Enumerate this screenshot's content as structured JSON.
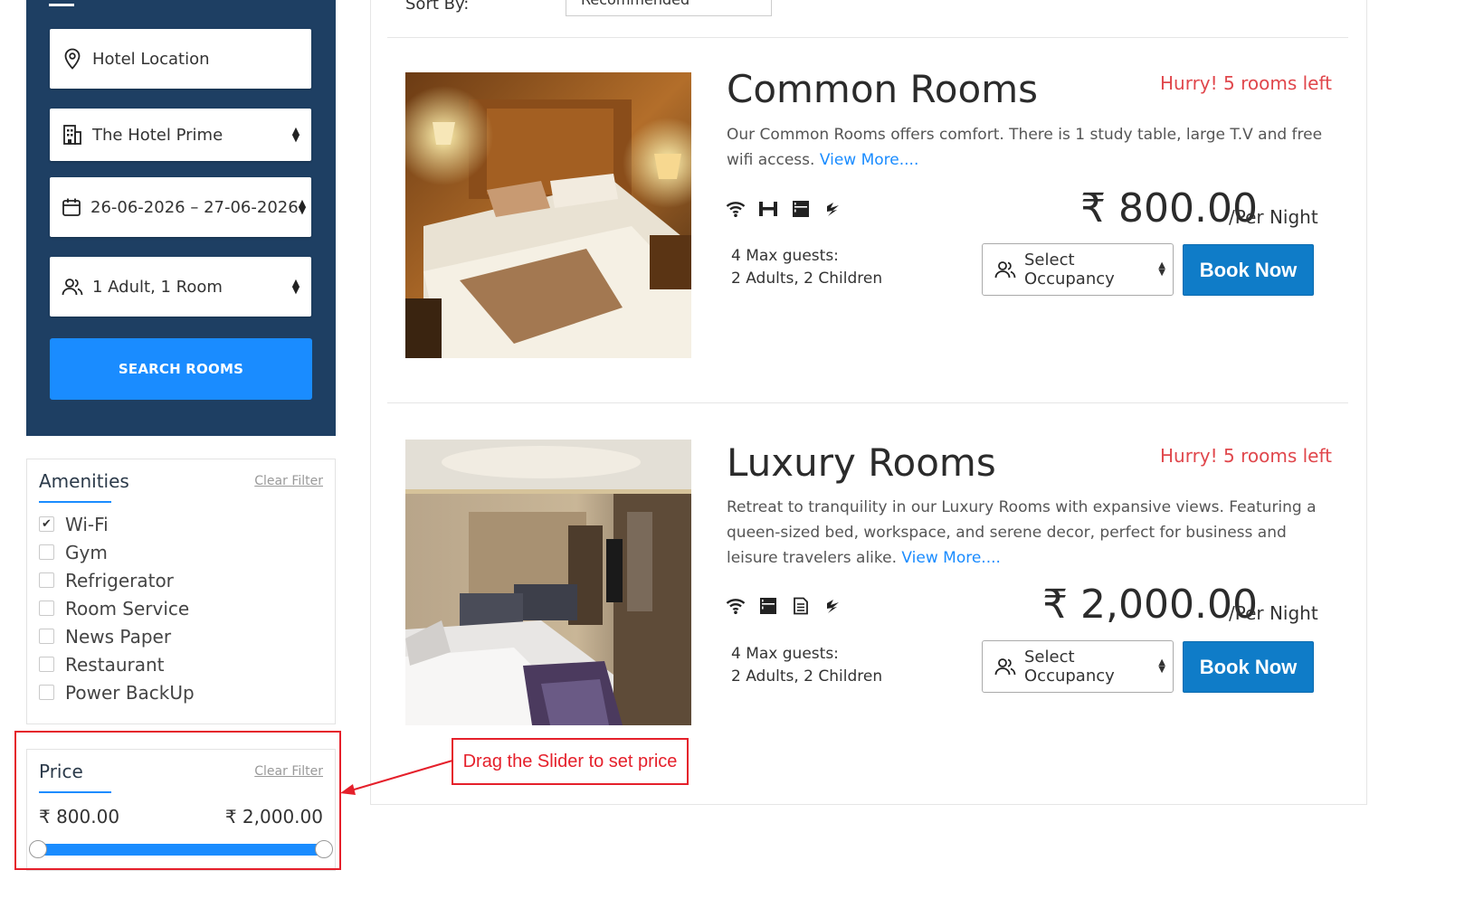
{
  "search": {
    "location_placeholder": "Hotel Location",
    "hotel": "The Hotel Prime",
    "check_in": "26-06-2026",
    "date_separator": "–",
    "check_out": "27-06-2026",
    "occupancy": "1 Adult, 1 Room",
    "button": "SEARCH ROOMS"
  },
  "sort": {
    "label": "Sort By:",
    "value": "Recommended"
  },
  "filters": {
    "amenities": {
      "title": "Amenities",
      "clear": "Clear Filter",
      "items": [
        {
          "label": "Wi-Fi",
          "checked": true
        },
        {
          "label": "Gym",
          "checked": false
        },
        {
          "label": "Refrigerator",
          "checked": false
        },
        {
          "label": "Room Service",
          "checked": false
        },
        {
          "label": "News Paper",
          "checked": false
        },
        {
          "label": "Restaurant",
          "checked": false
        },
        {
          "label": "Power BackUp",
          "checked": false
        }
      ]
    },
    "price": {
      "title": "Price",
      "clear": "Clear Filter",
      "min": "₹ 800.00",
      "max": "₹ 2,000.00"
    }
  },
  "rooms": [
    {
      "title": "Common Rooms",
      "availability": "Hurry! 5 rooms left",
      "description": "Our Common Rooms offers comfort. There is 1 study table, large T.V and free wifi access.",
      "more": "View More....",
      "price": "₹ 800.00",
      "per": "/Per Night",
      "max_guests": "4 Max guests:",
      "guest_detail": "2 Adults, 2 Children",
      "occupancy": "Select Occupancy",
      "book": "Book Now",
      "amenity_icons": [
        "wifi-icon",
        "gym-icon",
        "refrigerator-icon",
        "power-backup-icon"
      ]
    },
    {
      "title": "Luxury Rooms",
      "availability": "Hurry! 5 rooms left",
      "description": "Retreat to tranquility in our Luxury Rooms with expansive views. Featuring a queen-sized bed, workspace, and serene decor, perfect for business and leisure travelers alike.",
      "more": "View More....",
      "price": "₹ 2,000.00",
      "per": "/Per Night",
      "max_guests": "4 Max guests:",
      "guest_detail": "2 Adults, 2 Children",
      "occupancy": "Select Occupancy",
      "book": "Book Now",
      "amenity_icons": [
        "wifi-icon",
        "refrigerator-icon",
        "news-paper-icon",
        "power-backup-icon"
      ]
    }
  ],
  "annotation": "Drag the Slider to set price",
  "colors": {
    "panel": "#1e3f63",
    "accent": "#1a8cff",
    "book": "#0f7cc8",
    "hurry": "#e0474c",
    "callout": "#e5202b"
  }
}
